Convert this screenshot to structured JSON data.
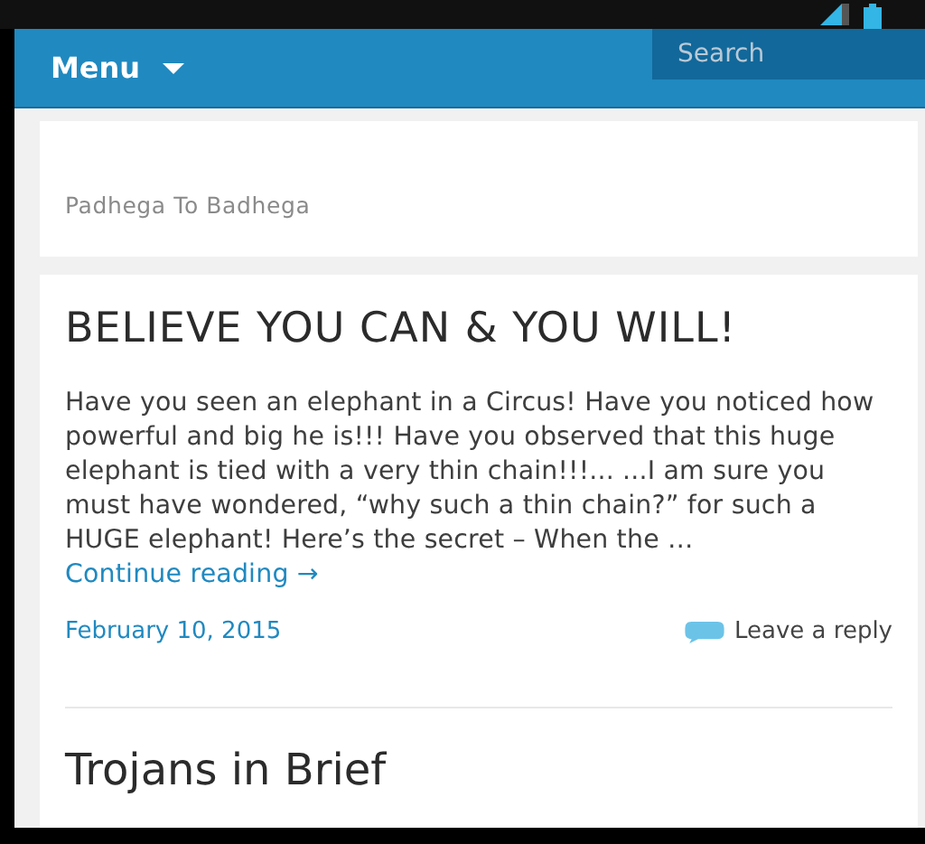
{
  "header": {
    "menu_label": "Menu",
    "search": {
      "placeholder": "Search"
    }
  },
  "site_card": {
    "tagline": "Padhega To Badhega"
  },
  "post": {
    "title": "BELIEVE YOU CAN & YOU WILL!",
    "excerpt": "Have you seen an elephant in a Circus! Have you noticed how powerful and big he is!!! Have you observed that this huge elephant is tied with a very thin chain!!!... ...I am sure you must have wondered, “why such a thin chain?” for such a HUGE elephant! Here’s the secret – When the …",
    "continue_link": "Continue reading →",
    "date": "February 10, 2015",
    "reply_link": "Leave a reply"
  },
  "next_post": {
    "title": "Trojans in Brief"
  }
}
